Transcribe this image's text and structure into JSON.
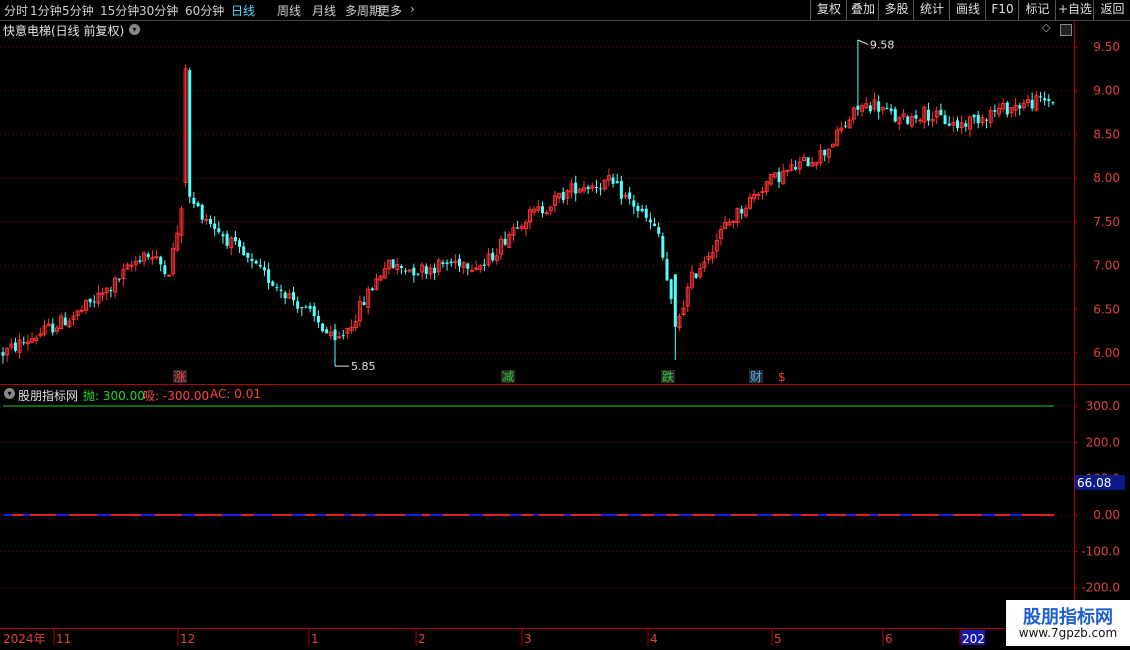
{
  "toolbar": {
    "periods": [
      "分时",
      "1分钟",
      "5分钟",
      "15分钟",
      "30分钟",
      "60分钟",
      "日线",
      "周线",
      "月线",
      "多周期",
      "更多"
    ],
    "active_period": "日线",
    "right_buttons": [
      "复权",
      "叠加",
      "多股",
      "统计",
      "画线",
      "F10",
      "标记",
      "+自选",
      "返回"
    ]
  },
  "main_chart": {
    "title": "快意电梯(日线 前复权)",
    "price_ticks": [
      "9.50",
      "9.00",
      "8.50",
      "8.00",
      "7.50",
      "7.00",
      "6.50",
      "6.00"
    ],
    "high_label": "9.58",
    "low_label": "5.85",
    "event_markers": [
      {
        "text": "涨",
        "color": "#ff4444"
      },
      {
        "text": "减",
        "color": "#33cc33"
      },
      {
        "text": "跌",
        "color": "#33cc33"
      },
      {
        "text": "财",
        "color": "#4aa8ff"
      },
      {
        "text": "$",
        "color": "#ff3333"
      }
    ]
  },
  "indicator": {
    "name": "股朋指标网",
    "throw_label": "抛:",
    "throw_value": "300.00",
    "absorb_label": "吸:",
    "absorb_value": "-300.00",
    "ac_label": "AC:",
    "ac_value": "0.01",
    "ticks": [
      "300.0",
      "200.0",
      "100.0",
      "0.00",
      "-100.0",
      "-200.0"
    ],
    "current_value": "66.08"
  },
  "date_axis": {
    "labels": [
      "2024年",
      "11",
      "12",
      "1",
      "2",
      "3",
      "4",
      "5",
      "6",
      "202"
    ]
  },
  "watermark": {
    "title": "股朋指标网",
    "url": "www.7gpzb.com"
  },
  "colors": {
    "up": "#ff3333",
    "down": "#54ffff",
    "axis": "#b00000",
    "grid": "#8a0000",
    "background": "#000000"
  }
}
